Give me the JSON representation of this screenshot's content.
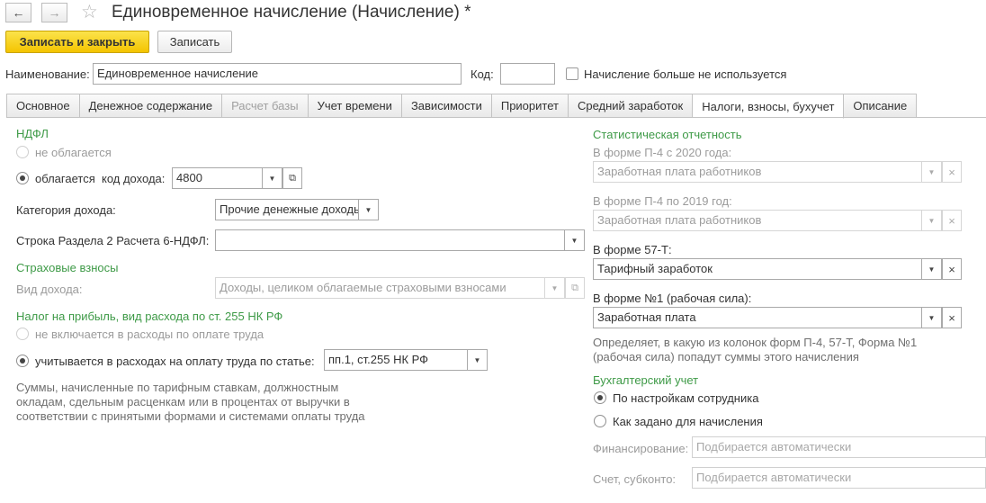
{
  "window": {
    "title": "Единовременное начисление (Начисление) *",
    "back_icon": "←",
    "forward_icon": "→",
    "star_icon": "☆"
  },
  "toolbar": {
    "save_close_label": "Записать и закрыть",
    "save_label": "Записать"
  },
  "header": {
    "name_label": "Наименование:",
    "name_value": "Единовременное начисление",
    "code_label": "Код:",
    "code_value": "",
    "unused_label": "Начисление больше не используется"
  },
  "tabs": [
    "Основное",
    "Денежное содержание",
    "Расчет базы",
    "Учет времени",
    "Зависимости",
    "Приоритет",
    "Средний заработок",
    "Налоги, взносы, бухучет",
    "Описание"
  ],
  "left": {
    "ndfl_heading": "НДФЛ",
    "not_taxed_label": "не облагается",
    "taxed_label": "облагается",
    "income_code_label": "код дохода:",
    "income_code_value": "4800",
    "income_category_label": "Категория дохода:",
    "income_category_value": "Прочие денежные доходы",
    "row6_label": "Строка Раздела 2 Расчета 6-НДФЛ:",
    "row6_value": "",
    "insurance_heading": "Страховые взносы",
    "income_kind_label": "Вид дохода:",
    "income_kind_value": "Доходы, целиком облагаемые страховыми взносами",
    "profit_tax_heading": "Налог на прибыль, вид расхода по ст. 255 НК РФ",
    "not_included_label": "не включается в расходы по оплате труда",
    "included_label": "учитывается в расходах на оплату труда по статье:",
    "article_value": "пп.1, ст.255 НК РФ",
    "note": "Суммы, начисленные по тарифным ставкам, должностным окладам, сдельным расценкам или в процентах от выручки в соответствии с принятыми формами и системами оплаты труда"
  },
  "right": {
    "stat_heading": "Статистическая отчетность",
    "p4_2020_label": "В форме П-4 с 2020 года:",
    "p4_2020_value": "Заработная плата работников",
    "p4_2019_label": "В форме П-4 по 2019 год:",
    "p4_2019_value": "Заработная плата работников",
    "f57_label": "В форме 57-Т:",
    "f57_value": "Тарифный заработок",
    "f1_label": "В форме №1 (рабочая сила):",
    "f1_value": "Заработная плата",
    "stat_note": "Определяет, в какую из колонок форм П-4, 57-Т, Форма №1 (рабочая сила) попадут суммы этого начисления",
    "acc_heading": "Бухгалтерский учет",
    "acc_by_employee_label": "По настройкам сотрудника",
    "acc_as_set_label": "Как задано для начисления",
    "financing_label": "Финансирование:",
    "financing_placeholder": "Подбирается автоматически",
    "account_label": "Счет, субконто:",
    "account_placeholder": "Подбирается автоматически"
  },
  "icons": {
    "dropdown": "▼",
    "clear": "×",
    "open": "⧉"
  }
}
